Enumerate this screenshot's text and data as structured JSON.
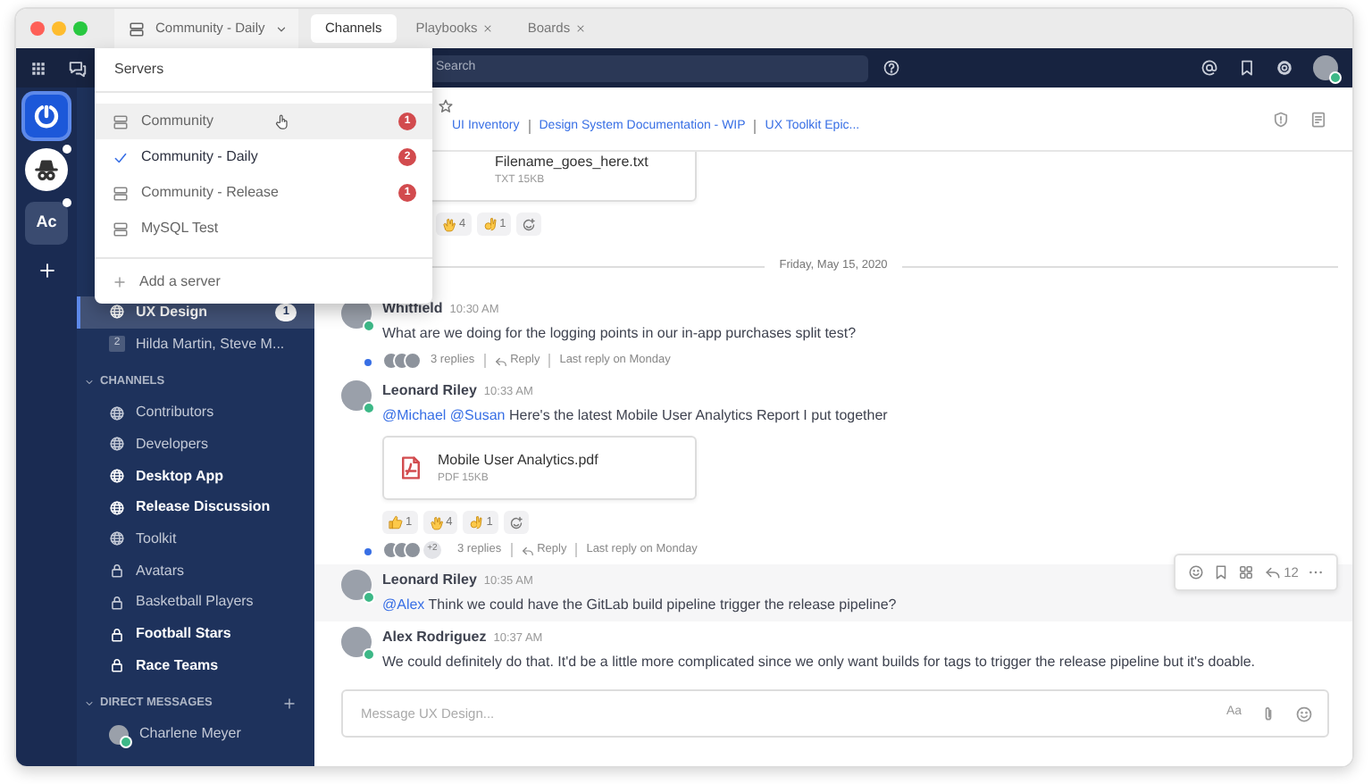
{
  "title_bar": {
    "server_selector": {
      "label": "Community - Daily"
    },
    "tabs": [
      {
        "label": "Channels",
        "selected": true,
        "closable": false
      },
      {
        "label": "Playbooks",
        "selected": false,
        "closable": true
      },
      {
        "label": "Boards",
        "selected": false,
        "closable": true
      }
    ]
  },
  "top_bar": {
    "search": {
      "placeholder": "Search"
    }
  },
  "teams": [
    {
      "kind": "logo",
      "selected": true,
      "unread": false
    },
    {
      "kind": "avatar",
      "selected": false,
      "unread": true
    },
    {
      "kind": "initials",
      "label": "Ac",
      "selected": false,
      "unread": true
    }
  ],
  "server_menu": {
    "title": "Servers",
    "servers": [
      {
        "name": "Community",
        "selected": false,
        "hovered": true,
        "badge": "1"
      },
      {
        "name": "Community - Daily",
        "selected": true,
        "hovered": false,
        "badge": "2"
      },
      {
        "name": "Community - Release",
        "selected": false,
        "hovered": false,
        "badge": "1"
      },
      {
        "name": "MySQL Test",
        "selected": false,
        "hovered": false
      }
    ],
    "add_label": "Add a server"
  },
  "sidebar": {
    "pinned": [
      {
        "kind": "public",
        "name": "UX Design",
        "badge": "1",
        "selected": true,
        "unread": true
      },
      {
        "kind": "group",
        "name": "Hilda Martin, Steve M...",
        "count": "2",
        "selected": false,
        "unread": false
      }
    ],
    "sections": [
      {
        "title": "CHANNELS",
        "addable": false,
        "items": [
          {
            "kind": "public",
            "name": "Contributors",
            "unread": false
          },
          {
            "kind": "public",
            "name": "Developers",
            "unread": false
          },
          {
            "kind": "public",
            "name": "Desktop App",
            "unread": true
          },
          {
            "kind": "public",
            "name": "Release Discussion",
            "unread": true
          },
          {
            "kind": "public",
            "name": "Toolkit",
            "unread": false
          },
          {
            "kind": "private",
            "name": "Avatars",
            "unread": false
          },
          {
            "kind": "private",
            "name": "Basketball Players",
            "unread": false
          },
          {
            "kind": "private",
            "name": "Football Stars",
            "unread": true
          },
          {
            "kind": "private",
            "name": "Race Teams",
            "unread": true
          }
        ]
      },
      {
        "title": "DIRECT MESSAGES",
        "addable": true,
        "items": [
          {
            "kind": "dm",
            "name": "Charlene Meyer",
            "unread": false
          }
        ]
      }
    ]
  },
  "channel_header": {
    "links": [
      "UI Inventory",
      "Design System Documentation - WIP",
      "UX Toolkit Epic..."
    ]
  },
  "posts": [
    {
      "kind": "tail",
      "file": {
        "kind": "txt",
        "name": "Filename_goes_here.txt",
        "meta": "TXT 15KB"
      },
      "reactions": [
        {
          "kind": "clap",
          "count": "4"
        },
        {
          "kind": "ok",
          "count": "1"
        }
      ]
    },
    {
      "kind": "separator",
      "label": "Friday, May 15, 2020"
    },
    {
      "kind": "post",
      "author": "Whitfield",
      "time": "10:30 AM",
      "text": "What are we doing for the logging points in our in-app purchases split test?",
      "thread": {
        "replies": "3 replies",
        "reply": "Reply",
        "last": "Last reply on Monday"
      },
      "hovered": false
    },
    {
      "kind": "post",
      "author": "Leonard Riley",
      "time": "10:33 AM",
      "mentions": [
        "@Michael",
        "@Susan"
      ],
      "text": "Here's the latest Mobile User Analytics Report I put together",
      "file": {
        "kind": "pdf",
        "name": "Mobile User Analytics.pdf",
        "meta": "PDF 15KB"
      },
      "reactions": [
        {
          "kind": "thumbs",
          "count": "1"
        },
        {
          "kind": "clap",
          "count": "4"
        },
        {
          "kind": "ok",
          "count": "1"
        }
      ],
      "thread": {
        "extra": "+2",
        "replies": "3 replies",
        "reply": "Reply",
        "last": "Last reply on Monday"
      },
      "hovered": false
    },
    {
      "kind": "post",
      "author": "Leonard Riley",
      "time": "10:35 AM",
      "mentions": [
        "@Alex"
      ],
      "text": "Think we could have the GitLab build pipeline trigger the release pipeline?",
      "hovered": true,
      "reply_count": "12"
    },
    {
      "kind": "post",
      "author": "Alex Rodriguez",
      "time": "10:37 AM",
      "text": "We could definitely do that. It'd be a little more complicated since we only want builds for tags to trigger the release pipeline but it's doable.",
      "hovered": false
    }
  ],
  "composer": {
    "placeholder": "Message UX Design...",
    "format_label": "Aa"
  }
}
